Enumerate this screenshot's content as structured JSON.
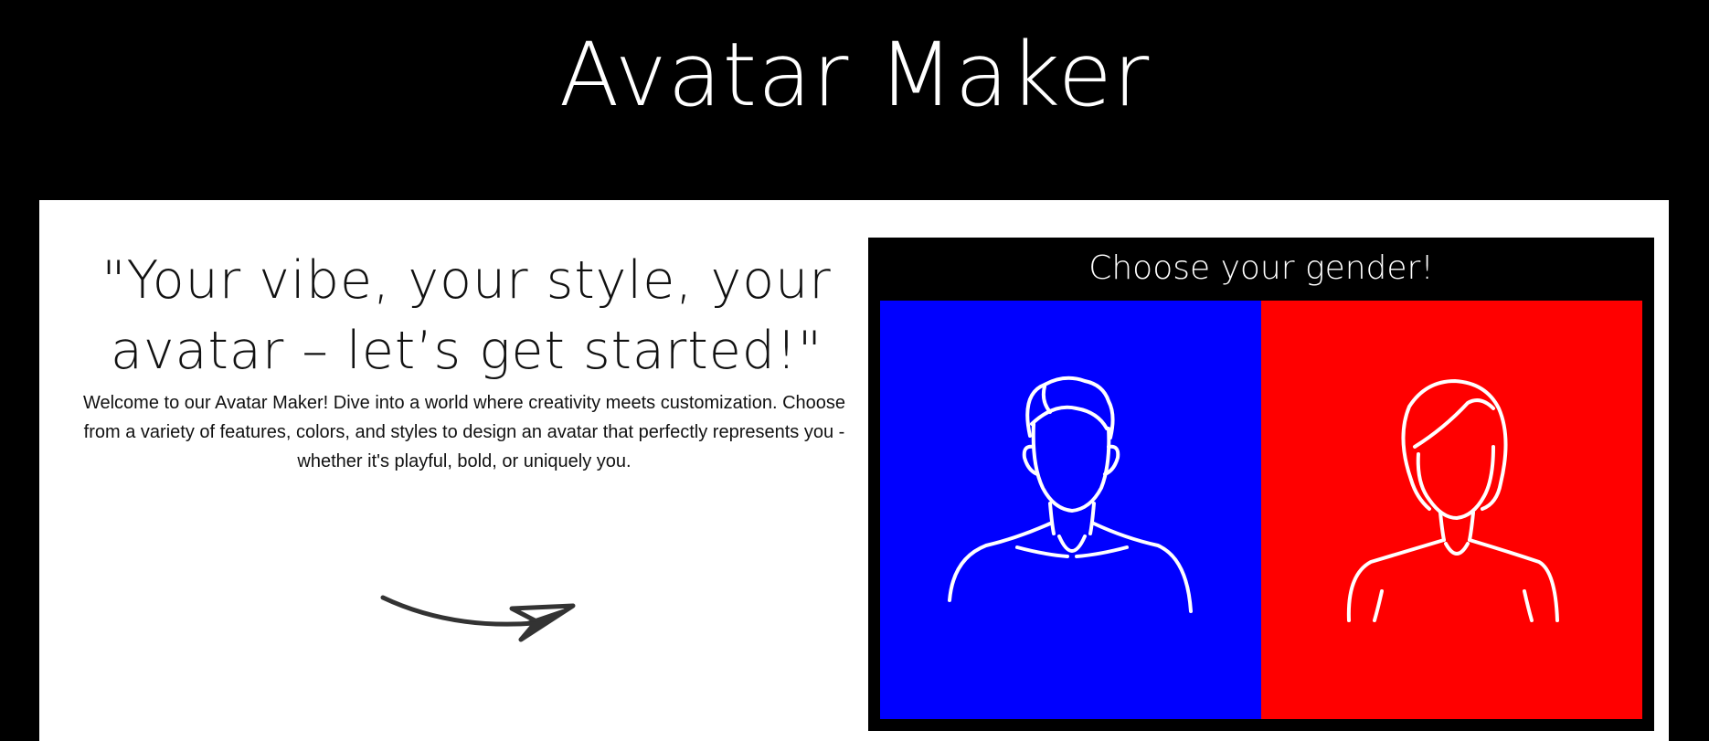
{
  "header": {
    "title": "Avatar Maker"
  },
  "intro": {
    "tagline": "\"Your vibe, your style, your avatar – let’s get started!\"",
    "welcome_text": "Welcome to our Avatar Maker! Dive into a world where creativity meets customization. Choose from a variety of features, colors, and styles to design an avatar that perfectly represents you - whether it's playful, bold, or uniquely you.",
    "arrow_icon": "curved-arrow-right-icon"
  },
  "gender_picker": {
    "heading": "Choose your gender!",
    "options": [
      {
        "id": "male",
        "icon": "male-silhouette-icon",
        "color": "#0000ff"
      },
      {
        "id": "female",
        "icon": "female-silhouette-icon",
        "color": "#ff0000"
      }
    ]
  },
  "colors": {
    "background": "#000000",
    "card": "#ffffff",
    "male": "#0000ff",
    "female": "#ff0000"
  }
}
